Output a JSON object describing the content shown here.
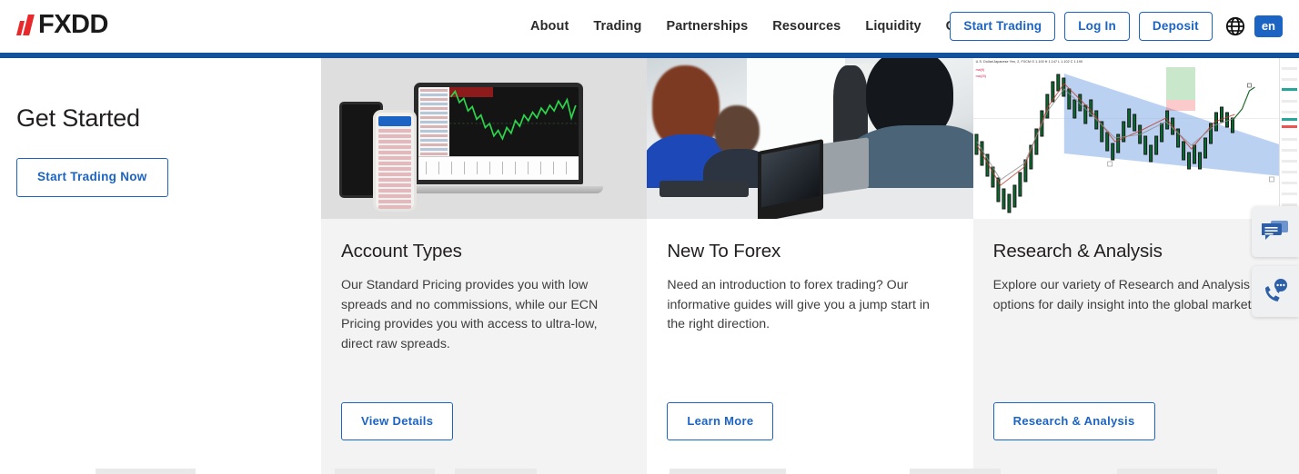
{
  "header": {
    "logo_text": "FXDD",
    "logo_icon": "fxdd-bars-icon",
    "nav": [
      {
        "label": "About"
      },
      {
        "label": "Trading"
      },
      {
        "label": "Partnerships"
      },
      {
        "label": "Resources"
      },
      {
        "label": "Liquidity"
      },
      {
        "label": "Contact"
      }
    ],
    "actions": {
      "start_trading": "Start Trading",
      "log_in": "Log In",
      "deposit": "Deposit"
    },
    "language": {
      "globe_icon": "globe-icon",
      "current": "en"
    },
    "accent_color": "#1b64c4",
    "rule_color": "#13509c"
  },
  "sidebar": {
    "heading": "Get Started",
    "cta_label": "Start Trading Now"
  },
  "cards": [
    {
      "media_icon": "trading-platforms-image",
      "title": "Account Types",
      "description": "Our Standard Pricing provides you with low spreads and no commissions, while our ECN Pricing provides you with access to ultra-low, direct raw spreads.",
      "cta_label": "View Details",
      "background": "#f3f3f3"
    },
    {
      "media_icon": "forex-seminar-photo",
      "title": "New To Forex",
      "description": "Need an introduction to forex trading? Our informative guides will give you a jump start in the right direction.",
      "cta_label": "Learn More",
      "background": "#ffffff"
    },
    {
      "media_icon": "market-analysis-chart-image",
      "title": "Research & Analysis",
      "description": "Explore our variety of Research and Analysis options for daily insight into the global markets.",
      "cta_label": "Research & Analysis",
      "background": "#f3f3f3"
    }
  ],
  "float_widgets": [
    {
      "icon": "chat-bubbles-icon",
      "label": "Live Chat"
    },
    {
      "icon": "phone-callback-icon",
      "label": "Request a Callback"
    }
  ],
  "chart_art": {
    "symbol_line": "U.S. Dollar/Japanese Yen, 2, FXCM   O 1.100  H 1.147  L 1.102  C 1.190",
    "sub_line_1": "ma(9)",
    "sub_line_2": "ma(20)"
  }
}
